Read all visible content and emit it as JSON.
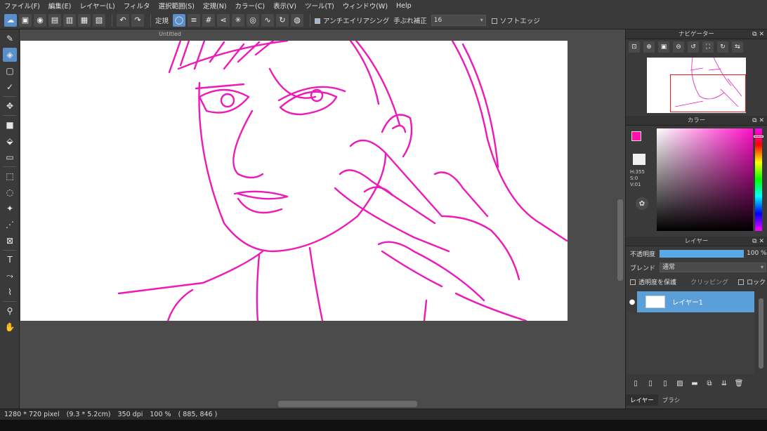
{
  "menu": [
    "ファイル(F)",
    "編集(E)",
    "レイヤー(L)",
    "フィルタ",
    "選択範囲(S)",
    "定規(N)",
    "カラー(C)",
    "表示(V)",
    "ツール(T)",
    "ウィンドウ(W)",
    "Help"
  ],
  "toolbar": {
    "ruler_label": "定規",
    "antialias_label": "アンチエイリアシング",
    "stabilizer_label": "手ぶれ補正",
    "stabilizer_value": "16",
    "soft_edge_label": "ソフトエッジ"
  },
  "document": {
    "tab_name": "Untitled"
  },
  "status": {
    "size": "1280 * 720 pixel",
    "physical": "(9.3 * 5.2cm)",
    "dpi": "350 dpi",
    "zoom": "100 %",
    "coords": "( 885, 846 )"
  },
  "navigator": {
    "title": "ナビゲーター"
  },
  "color": {
    "title": "カラー",
    "foreground": "#ff10a8",
    "h": "H:355",
    "s": "S:0",
    "v": "V:01"
  },
  "layers": {
    "title": "レイヤー",
    "opacity_label": "不透明度",
    "opacity_value": "100 %",
    "opacity_fraction": 1.0,
    "blend_label": "ブレンド",
    "blend_value": "通常",
    "protect_alpha_label": "透明度を保護",
    "clipping_label": "クリッピング",
    "lock_label": "ロック",
    "items": [
      {
        "name": "レイヤー1"
      }
    ]
  },
  "panel_tabs": [
    "レイヤー",
    "ブラシ"
  ]
}
